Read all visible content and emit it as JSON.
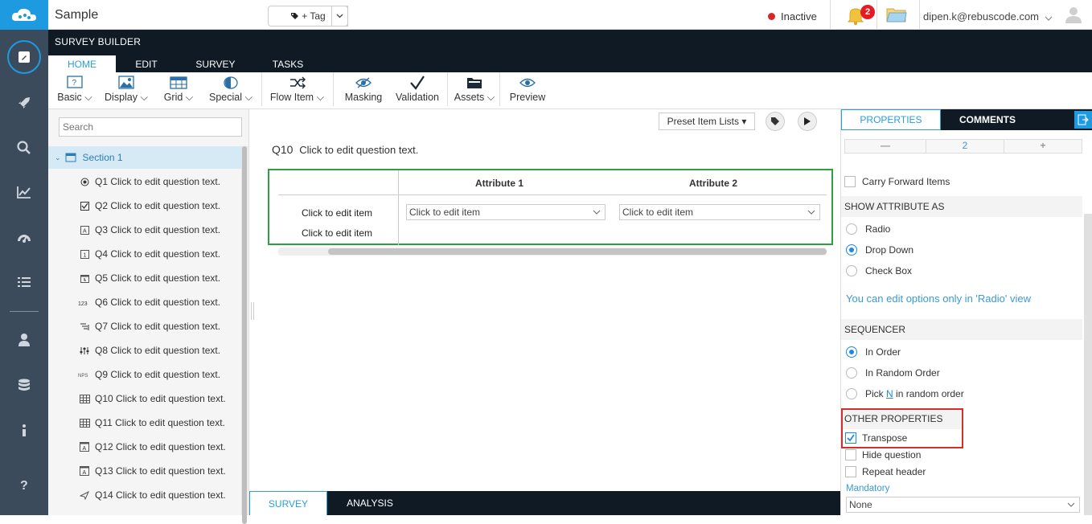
{
  "app": {
    "title": "Sample",
    "tag_label": "+ Tag",
    "status": "Inactive",
    "notif_count": "2",
    "user_email": "dipen.k@rebuscode.com"
  },
  "header": {
    "title": "SURVEY BUILDER",
    "tabs": [
      "HOME",
      "EDIT",
      "SURVEY",
      "TASKS"
    ]
  },
  "toolbar": {
    "basic": "Basic",
    "display": "Display",
    "grid": "Grid",
    "special": "Special",
    "flow": "Flow Item",
    "masking": "Masking",
    "validation": "Validation",
    "assets": "Assets",
    "preview": "Preview"
  },
  "tree": {
    "search_placeholder": "Search",
    "section": "Section 1",
    "questions": [
      {
        "icon": "radio-icon",
        "label": "Q1 Click to edit question text."
      },
      {
        "icon": "checkbox-icon",
        "label": "Q2 Click to edit question text."
      },
      {
        "icon": "text-icon",
        "label": "Q3 Click to edit question text."
      },
      {
        "icon": "number-icon",
        "label": "Q4 Click to edit question text."
      },
      {
        "icon": "date-icon",
        "label": "Q5 Click to edit question text."
      },
      {
        "icon": "rank-icon",
        "label": "Q6 Click to edit question text."
      },
      {
        "icon": "list-icon",
        "label": "Q7 Click to edit question text."
      },
      {
        "icon": "slider-icon",
        "label": "Q8 Click to edit question text."
      },
      {
        "icon": "nps-icon",
        "label": "Q9 Click to edit question text."
      },
      {
        "icon": "grid-icon",
        "label": "Q10 Click to edit question text."
      },
      {
        "icon": "grid-icon",
        "label": "Q11 Click to edit question text."
      },
      {
        "icon": "text-grid-icon",
        "label": "Q12 Click to edit question text."
      },
      {
        "icon": "text-grid-icon",
        "label": "Q13 Click to edit question text."
      },
      {
        "icon": "send-icon",
        "label": "Q14 Click to edit question text."
      }
    ]
  },
  "center": {
    "preset_label": "Preset Item Lists ▾",
    "q_num": "Q10",
    "q_text": "Click to edit question text.",
    "attributes": [
      "Attribute 1",
      "Attribute 2"
    ],
    "items": [
      "Click to edit item",
      "Click to edit item"
    ],
    "dropdown_value": "Click to edit item",
    "bottom_tabs": [
      "SURVEY",
      "ANALYSIS"
    ]
  },
  "right": {
    "tabs": [
      "PROPERTIES",
      "COMMENTS"
    ],
    "stepper_value": "2",
    "carry_forward": "Carry Forward Items",
    "show_attr_head": "SHOW ATTRIBUTE AS",
    "show_attr_opts": [
      "Radio",
      "Drop Down",
      "Check Box"
    ],
    "show_attr_selected": 1,
    "radio_note": "You can edit options only in 'Radio' view",
    "seq_head": "SEQUENCER",
    "seq_opts": [
      "In Order",
      "In Random Order"
    ],
    "seq_pick": {
      "pre": "Pick ",
      "n": "N",
      "post": " in random order"
    },
    "seq_selected": 0,
    "other_head": "OTHER PROPERTIES",
    "transpose": "Transpose",
    "hide_q": "Hide question",
    "repeat_header": "Repeat header",
    "mandatory_label": "Mandatory",
    "mandatory_value": "None"
  },
  "colors": {
    "accent": "#1e9be0",
    "dark": "#0f1a24",
    "rail": "#3b4b5c",
    "green_frame": "#2ea043",
    "red_highlight": "#d32f2f"
  }
}
